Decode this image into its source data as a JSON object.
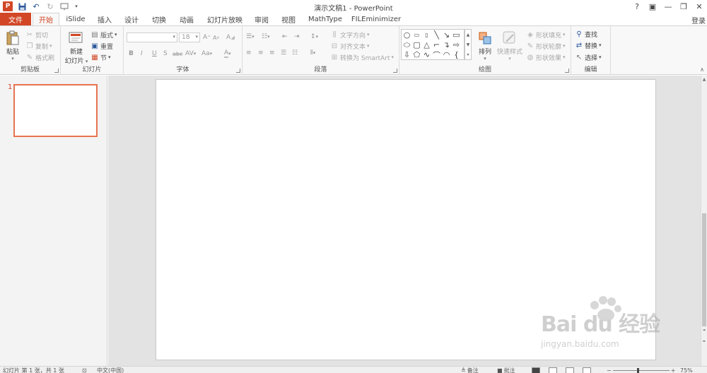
{
  "title_bar": {
    "app_logo": "P",
    "window_title": "演示文稿1 - PowerPoint",
    "controls": [
      "?",
      "▣",
      "—",
      "❐",
      "✕"
    ]
  },
  "tabs": {
    "file": "文件",
    "items": [
      "开始",
      "iSlide",
      "插入",
      "设计",
      "切换",
      "动画",
      "幻灯片放映",
      "审阅",
      "视图",
      "MathType",
      "FILEminimizer"
    ],
    "active": "开始",
    "login": "登录"
  },
  "ribbon": {
    "clipboard": {
      "label": "剪贴板",
      "paste": "粘贴",
      "cut": "剪切",
      "copy": "复制",
      "format_painter": "格式刷"
    },
    "slides": {
      "label": "幻灯片",
      "new_slide_line1": "新建",
      "new_slide_line2": "幻灯片",
      "layout": "版式",
      "reset": "重置",
      "section": "节"
    },
    "font": {
      "label": "字体",
      "font_name": "",
      "font_size": "18",
      "bold": "B",
      "italic": "I",
      "underline": "U",
      "shadow": "S",
      "strike": "abc",
      "spacing": "AV",
      "case": "Aa",
      "grow": "A",
      "shrink": "A",
      "clear": "A",
      "color": "A"
    },
    "paragraph": {
      "label": "段落",
      "text_direction": "文字方向",
      "align_text": "对齐文本",
      "smartart": "转换为 SmartArt"
    },
    "drawing": {
      "label": "绘图",
      "arrange": "排列",
      "quick_styles": "快速样式",
      "shape_fill": "形状填充",
      "shape_outline": "形状轮廓",
      "shape_effects": "形状效果"
    },
    "editing": {
      "label": "编辑",
      "find": "查找",
      "replace": "替换",
      "select": "选择"
    }
  },
  "slide_pane": {
    "thumbnail_number": "1"
  },
  "watermark": {
    "main": "Bai du 经验",
    "sub": "jingyan.baidu.com"
  },
  "status_bar": {
    "slide_info": "幻灯片 第 1 张，共 1 张",
    "language": "中文(中国)",
    "notes": "备注",
    "comments": "批注",
    "zoom": "75%"
  }
}
